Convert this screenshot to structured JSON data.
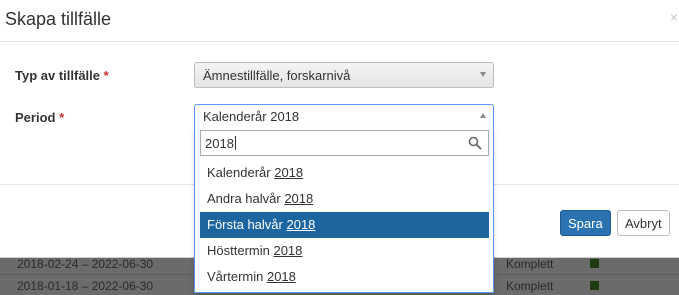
{
  "modal": {
    "title": "Skapa tillfälle",
    "close_glyph": "×"
  },
  "form": {
    "type": {
      "label": "Typ av tillfälle",
      "required_mark": "*",
      "value": "Ämnestillfälle, forskarnivå"
    },
    "period": {
      "label": "Period",
      "required_mark": "*",
      "value": "Kalenderår 2018"
    }
  },
  "dropdown": {
    "search_value": "2018",
    "options": [
      {
        "prefix": "Kalenderår ",
        "match": "2018"
      },
      {
        "prefix": "Andra halvår ",
        "match": "2018"
      },
      {
        "prefix": "Första halvår ",
        "match": "2018"
      },
      {
        "prefix": "Hösttermin ",
        "match": "2018"
      },
      {
        "prefix": "Vårtermin ",
        "match": "2018"
      }
    ],
    "highlighted_index": 2
  },
  "buttons": {
    "save": "Spara",
    "cancel": "Avbryt"
  },
  "background_rows": [
    {
      "date": "2018-02-24 – 2022-06-30",
      "status": "Komplett"
    },
    {
      "date": "2018-01-18 – 2022-06-30",
      "status": "Komplett"
    }
  ]
}
